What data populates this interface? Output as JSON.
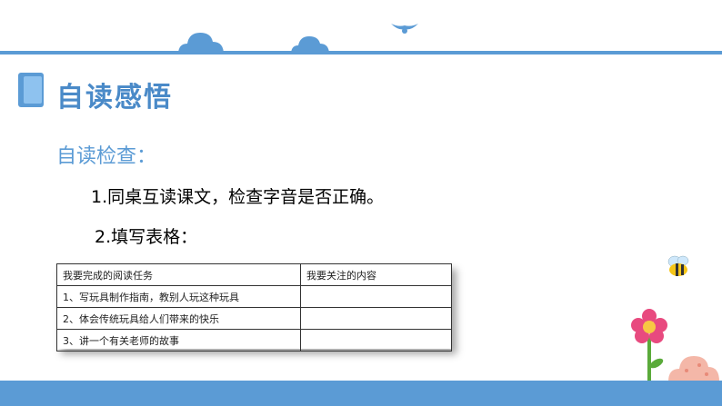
{
  "header": {
    "title": "自读感悟"
  },
  "section": {
    "subtitle": "自读检查："
  },
  "steps": [
    "1.同桌互读课文，检查字音是否正确。",
    "2.填写表格："
  ],
  "table": {
    "headers": [
      "我要完成的阅读任务",
      "我要关注的内容"
    ],
    "rows": [
      [
        "1、写玩具制作指南，教别人玩这种玩具",
        ""
      ],
      [
        "2、体会传统玩具给人们带来的快乐",
        ""
      ],
      [
        "3、讲一个有关老师的故事",
        ""
      ]
    ]
  },
  "colors": {
    "accent": "#5b9bd5",
    "title": "#4a8ac8"
  },
  "icons": [
    "cloud-icon",
    "bird-icon",
    "book-icon",
    "bee-icon",
    "flower-icon",
    "bush-icon"
  ]
}
